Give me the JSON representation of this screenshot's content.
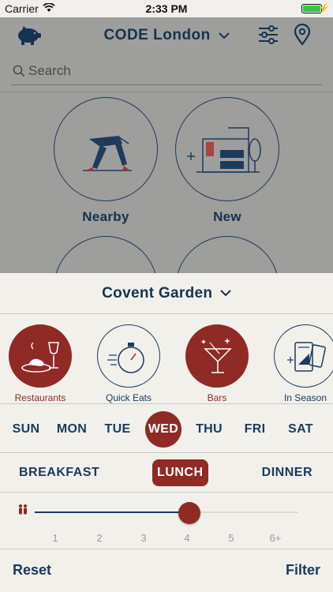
{
  "status_bar": {
    "carrier": "Carrier",
    "time": "2:33 PM"
  },
  "header": {
    "city": "CODE London"
  },
  "search": {
    "placeholder": "Search"
  },
  "categories": [
    {
      "label": "Nearby",
      "icon": "walking-person-icon"
    },
    {
      "label": "New",
      "icon": "storefront-icon"
    }
  ],
  "sheet": {
    "location": "Covent Garden",
    "types": [
      {
        "label": "Restaurants",
        "icon": "restaurant-icon",
        "selected": true
      },
      {
        "label": "Quick Eats",
        "icon": "stopwatch-icon",
        "selected": false
      },
      {
        "label": "Bars",
        "icon": "cocktail-icon",
        "selected": true
      },
      {
        "label": "In Season",
        "icon": "tickets-icon",
        "selected": false
      }
    ],
    "days": [
      "SUN",
      "MON",
      "TUE",
      "WED",
      "THU",
      "FRI",
      "SAT"
    ],
    "selected_day": "WED",
    "meals": [
      "BREAKFAST",
      "LUNCH",
      "DINNER"
    ],
    "selected_meal": "LUNCH",
    "party_size": {
      "options": [
        "1",
        "2",
        "3",
        "4",
        "5",
        "6+"
      ],
      "selected": "4"
    },
    "reset_label": "Reset",
    "filter_label": "Filter"
  },
  "colors": {
    "accent": "#8f2a25",
    "navy": "#1b3a5c",
    "sheet_bg": "#f1f0eb"
  }
}
